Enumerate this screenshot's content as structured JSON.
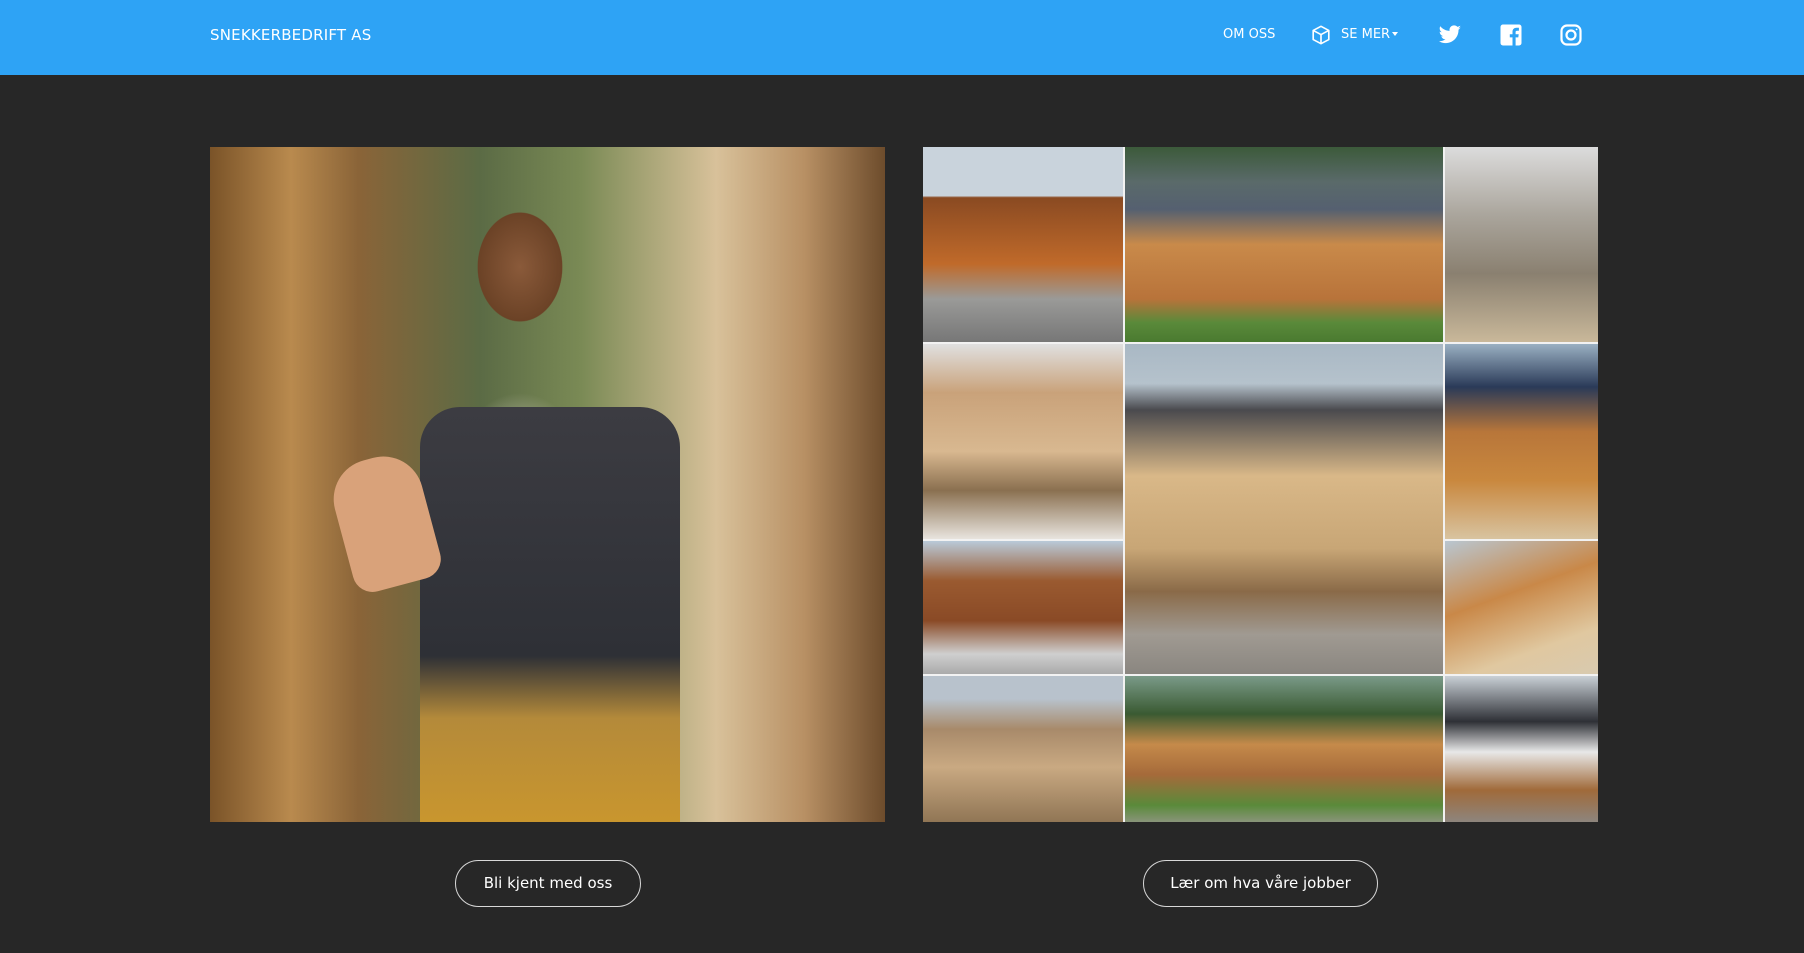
{
  "navbar": {
    "brand": "SNEKKERBEDRIFT AS",
    "links": {
      "about": "OM OSS",
      "more": "SE MER"
    },
    "background_color": "#2ea3f5",
    "social_icons": [
      "twitter-icon",
      "facebook-icon",
      "instagram-icon"
    ]
  },
  "main": {
    "background_color": "#272727",
    "left_image": {
      "subject": "smiling carpenter in apron waving in workshop"
    },
    "right_image": {
      "subject": "collage of wooden houses under construction"
    },
    "buttons": {
      "meet_us": "Bli kjent med oss",
      "learn_jobs": "Lær om hva våre jobber"
    }
  }
}
